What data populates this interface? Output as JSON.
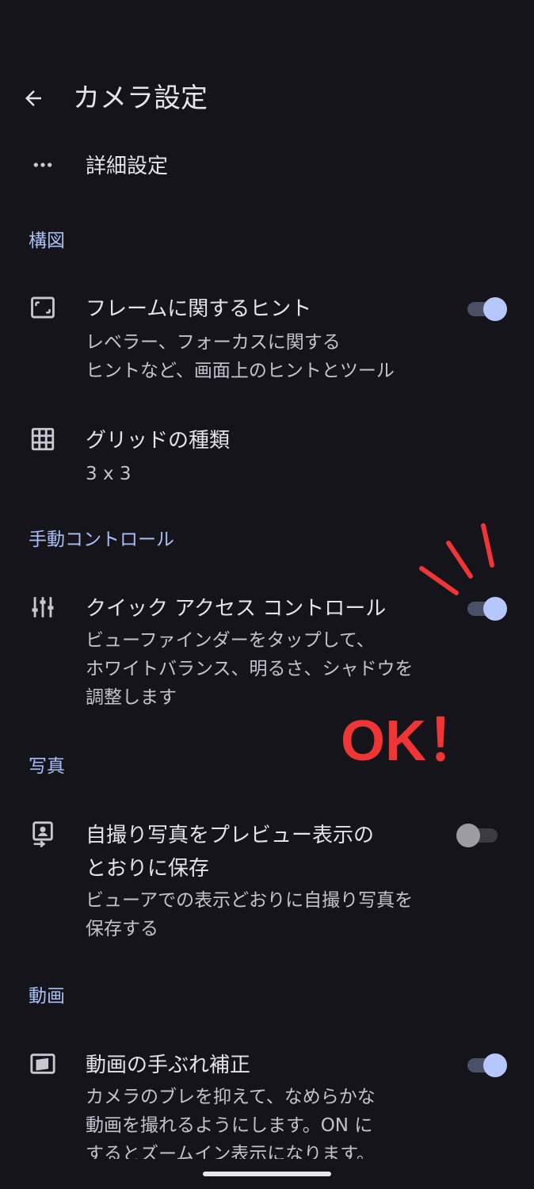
{
  "header": {
    "title": "カメラ設定"
  },
  "advanced": {
    "label": "詳細設定"
  },
  "sections": {
    "composition": "構図",
    "manual": "手動コントロール",
    "photo": "写真",
    "video": "動画"
  },
  "frame_hints": {
    "title": "フレームに関するヒント",
    "sub1": "レベラー、フォーカスに関する",
    "sub2": "ヒントなど、画面上のヒントとツール",
    "enabled": true
  },
  "grid_type": {
    "title": "グリッドの種類",
    "value": "3 x 3"
  },
  "quick_access": {
    "title": "クイック アクセス コントロール",
    "sub1": "ビューファインダーをタップして、",
    "sub2": "ホワイトバランス、明るさ、シャドウを",
    "sub3": "調整します",
    "enabled": true
  },
  "selfie_preview": {
    "title1": "自撮り写真をプレビュー表示の",
    "title2": "とおりに保存",
    "sub1": "ビューアでの表示どおりに自撮り写真を",
    "sub2": "保存する",
    "enabled": false
  },
  "stabilization": {
    "title": "動画の手ぶれ補正",
    "sub1": "カメラのブレを抑えて、なめらかな",
    "sub2": "動画を撮れるようにします。ON に",
    "sub3": "するとズームイン表示になります。",
    "enabled": true
  },
  "annotation": {
    "text": "OK！",
    "color": "#ef3535"
  },
  "colors": {
    "background": "#14141a",
    "accent": "#a9bff5",
    "toggle_on": "#b6c8fb"
  }
}
